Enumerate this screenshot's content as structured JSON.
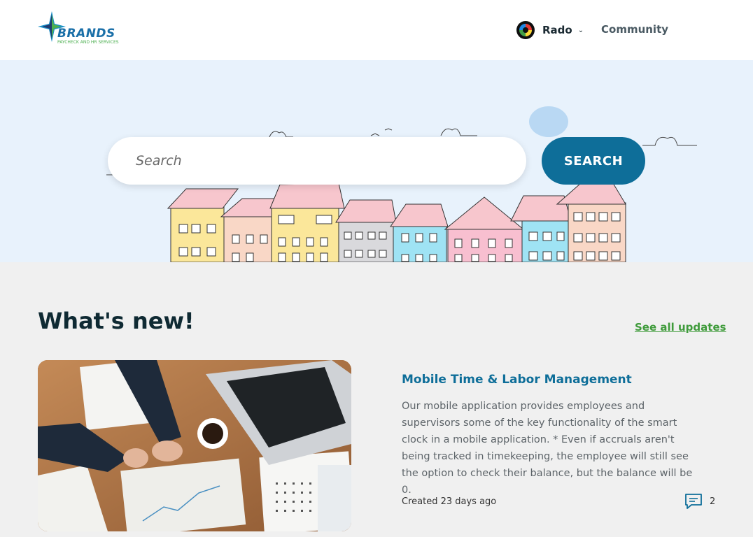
{
  "header": {
    "logo_text": "BRANDS",
    "logo_subtext": "PAYCHECK AND HR SERVICES",
    "user_name": "Rado",
    "community_label": "Community"
  },
  "hero": {
    "search_placeholder": "Search",
    "search_button_label": "SEARCH"
  },
  "whats_new": {
    "title": "What's new!",
    "see_all_label": "See all updates",
    "article": {
      "title": "Mobile Time & Labor Management",
      "description": "Our mobile application provides employees and supervisors some of the key functionality of the smart clock in a mobile application.  * Even if accruals aren't being tracked in timekeeping, the employee will still see the option to check their balance, but the balance will be 0.",
      "created": "Created 23 days ago",
      "comment_count": "2"
    }
  },
  "colors": {
    "brand_blue": "#0e6e99",
    "link_green": "#3f9b3b",
    "hero_bg": "#e8f2fc"
  }
}
